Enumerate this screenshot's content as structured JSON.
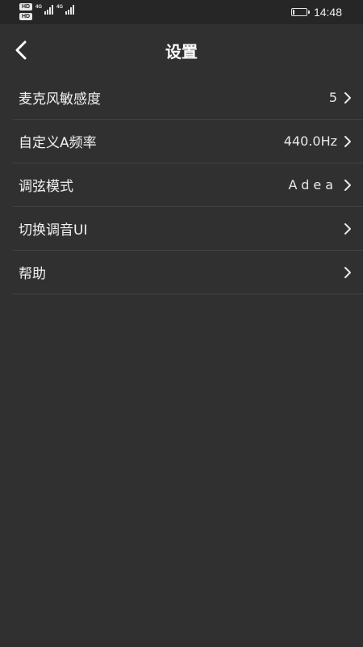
{
  "status_bar": {
    "hd_badges": [
      "HD",
      "HD"
    ],
    "signal_labels": [
      "4G",
      "4G"
    ],
    "signal_bars": [
      4,
      4
    ],
    "battery_level_percent": 15,
    "time": "14:48"
  },
  "header": {
    "title": "设置",
    "back_icon": "chevron-left-icon"
  },
  "settings": [
    {
      "label": "麦克风敏感度",
      "value": "5"
    },
    {
      "label": "自定义A频率",
      "value": "440.0Hz"
    },
    {
      "label": "调弦模式",
      "value": "Adea"
    },
    {
      "label": "切换调音UI",
      "value": ""
    },
    {
      "label": "帮助",
      "value": ""
    }
  ],
  "colors": {
    "background": "#303030",
    "status_bar": "#262626",
    "divider": "#424242",
    "text": "#ffffff"
  }
}
